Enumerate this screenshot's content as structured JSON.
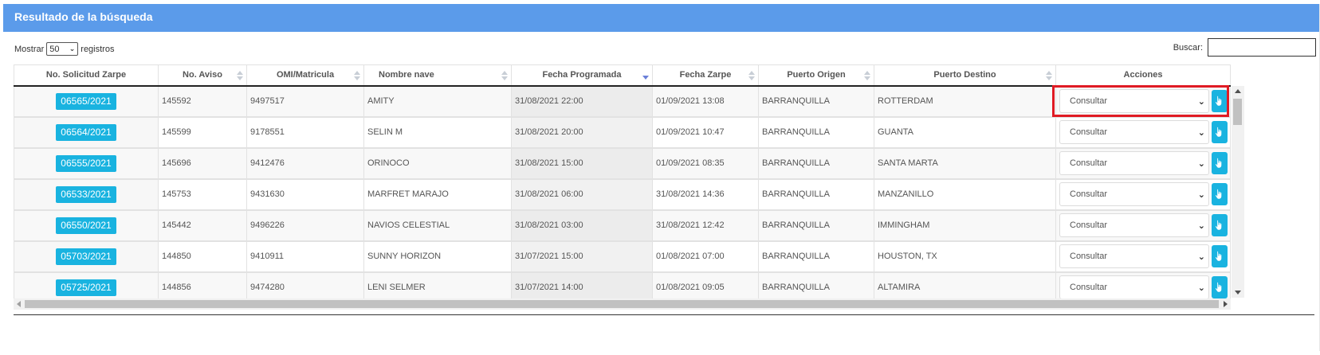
{
  "panel": {
    "title": "Resultado de la búsqueda"
  },
  "length_control": {
    "prefix": "Mostrar",
    "value": "50",
    "suffix": "registros"
  },
  "search": {
    "label": "Buscar:",
    "value": ""
  },
  "table": {
    "columns": [
      "No. Solicitud Zarpe",
      "No. Aviso",
      "OMI/Matricula",
      "Nombre nave",
      "Fecha Programada",
      "Fecha Zarpe",
      "Puerto Origen",
      "Puerto Destino",
      "Acciones"
    ],
    "sorted_column": "Fecha Programada",
    "sort_direction": "descending",
    "rows": [
      {
        "solicitud": "06565/2021",
        "aviso": "145592",
        "omi": "9497517",
        "nave": "AMITY",
        "programada": "31/08/2021 22:00",
        "zarpe": "01/09/2021 13:08",
        "origen": "BARRANQUILLA",
        "destino": "ROTTERDAM",
        "accion": "Consultar"
      },
      {
        "solicitud": "06564/2021",
        "aviso": "145599",
        "omi": "9178551",
        "nave": "SELIN M",
        "programada": "31/08/2021 20:00",
        "zarpe": "01/09/2021 10:47",
        "origen": "BARRANQUILLA",
        "destino": "GUANTA",
        "accion": "Consultar"
      },
      {
        "solicitud": "06555/2021",
        "aviso": "145696",
        "omi": "9412476",
        "nave": "ORINOCO",
        "programada": "31/08/2021 15:00",
        "zarpe": "01/09/2021 08:35",
        "origen": "BARRANQUILLA",
        "destino": "SANTA MARTA",
        "accion": "Consultar"
      },
      {
        "solicitud": "06533/2021",
        "aviso": "145753",
        "omi": "9431630",
        "nave": "MARFRET MARAJO",
        "programada": "31/08/2021 06:00",
        "zarpe": "31/08/2021 14:36",
        "origen": "BARRANQUILLA",
        "destino": "MANZANILLO",
        "accion": "Consultar"
      },
      {
        "solicitud": "06550/2021",
        "aviso": "145442",
        "omi": "9496226",
        "nave": "NAVIOS CELESTIAL",
        "programada": "31/08/2021 03:00",
        "zarpe": "31/08/2021 12:42",
        "origen": "BARRANQUILLA",
        "destino": "IMMINGHAM",
        "accion": "Consultar"
      },
      {
        "solicitud": "05703/2021",
        "aviso": "144850",
        "omi": "9410911",
        "nave": "SUNNY HORIZON",
        "programada": "31/07/2021 15:00",
        "zarpe": "01/08/2021 07:00",
        "origen": "BARRANQUILLA",
        "destino": "HOUSTON, TX",
        "accion": "Consultar"
      },
      {
        "solicitud": "05725/2021",
        "aviso": "144856",
        "omi": "9474280",
        "nave": "LENI SELMER",
        "programada": "31/07/2021 14:00",
        "zarpe": "01/08/2021 09:05",
        "origen": "BARRANQUILLA",
        "destino": "ALTAMIRA",
        "accion": "Consultar"
      }
    ]
  },
  "colors": {
    "header": "#5b9bea",
    "badge": "#19b3e0",
    "highlight": "#e01b24",
    "sort_active": "#6a7fd8"
  },
  "icons": {
    "action_button": "hand-pointer-icon",
    "select_arrow": "chevron-down-icon"
  }
}
